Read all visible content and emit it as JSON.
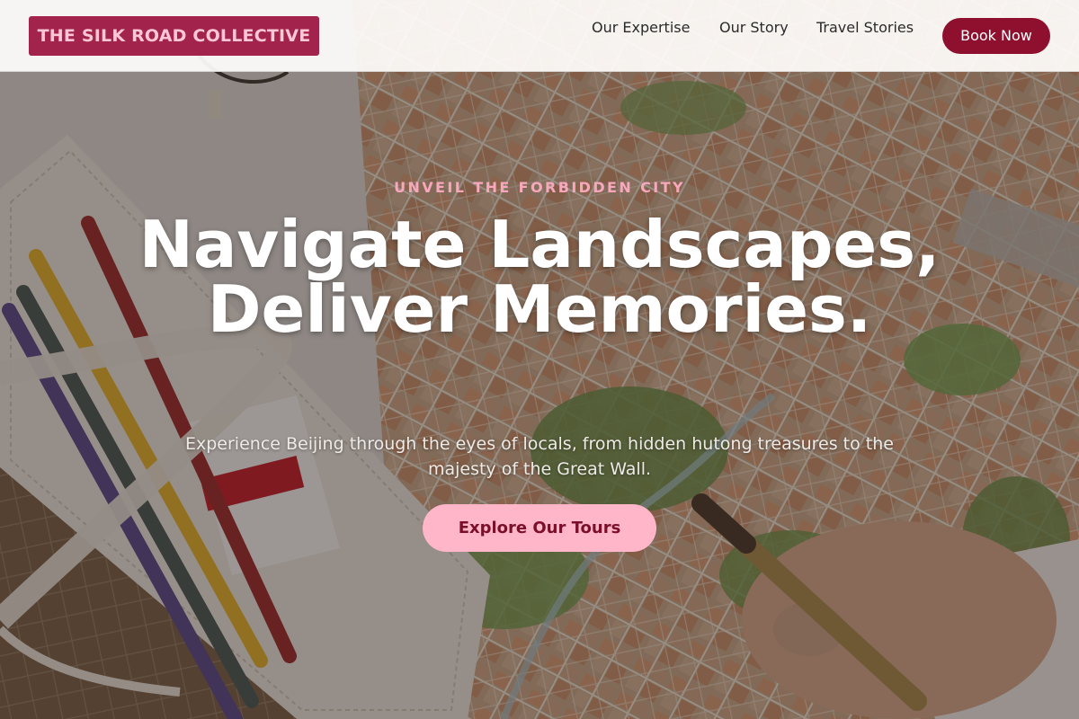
{
  "brand": {
    "name": "THE SILK ROAD COLLECTIVE",
    "accent_color": "#a2234b",
    "cta_color": "#8e0f2e",
    "highlight_color": "#ffb6c8"
  },
  "nav": {
    "items": [
      {
        "label": "Our Expertise"
      },
      {
        "label": "Our Story"
      },
      {
        "label": "Travel Stories"
      }
    ],
    "book_button": "Book Now"
  },
  "hero": {
    "eyebrow": "UNVEIL THE FORBIDDEN CITY",
    "headline": "Navigate Landscapes, Deliver Memories.",
    "subtitle": "Experience Beijing through the eyes of locals, from hidden hutong treasures to the majesty of the Great Wall.",
    "cta_label": "Explore Our Tours",
    "background": "map-and-pencils-photo"
  }
}
